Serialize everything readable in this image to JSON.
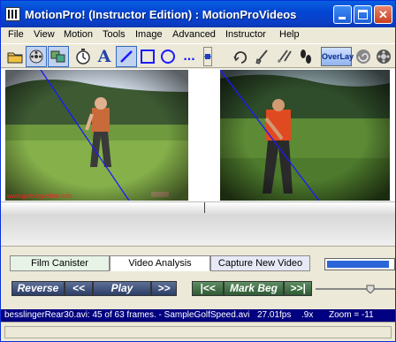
{
  "window": {
    "title": "MotionPro! (Instructor Edition) : MotionProVideos",
    "minimize_label": "",
    "maximize_label": "",
    "close_label": "✕"
  },
  "menu": [
    {
      "label": "File"
    },
    {
      "label": "View"
    },
    {
      "label": "Motion"
    },
    {
      "label": "Tools"
    },
    {
      "label": "Image"
    },
    {
      "label": "Advanced"
    },
    {
      "label": "Instructor"
    },
    {
      "label": "Help"
    }
  ],
  "toolbar": {
    "overlay_label": "OverLay",
    "text_tool": "A",
    "dots_tool": "...",
    "icons": [
      "open-folder-icon",
      "film-reel-icon",
      "compare-frames-icon",
      "stopwatch-icon",
      "text-tool-icon",
      "line-tool-icon",
      "rectangle-tool-icon",
      "circle-tool-icon",
      "more-tools-icon",
      "spin-control-icon",
      "redo-arrow-icon",
      "club-icon",
      "two-clubs-icon",
      "footprints-icon",
      "overlay-icon",
      "spiral-icon",
      "reel-icon"
    ]
  },
  "video": {
    "left_watermark": "www.golfsinglerfoto.info"
  },
  "tabs": {
    "film_canister": "Film Canister",
    "video_analysis": "Video Analysis",
    "capture_new_video": "Capture New Video"
  },
  "controls": {
    "reverse": "Reverse",
    "step_back": "<<",
    "play": "Play",
    "step_forward": ">>",
    "first_frame": "|<<",
    "mark_beg": "Mark Beg",
    "last_frame": ">>|"
  },
  "progress_fraction": 0.95,
  "status": {
    "file_info": "besslingerRear30.avi:  45 of 63 frames. - SampleGolfSpeed.avi",
    "fps": "27.01fps",
    "speed": ".9x",
    "zoom": "Zoom = -11"
  },
  "colors": {
    "titlebar": "#0346d4",
    "statusbar": "#000080",
    "overlay_line": "#1a1aff"
  }
}
